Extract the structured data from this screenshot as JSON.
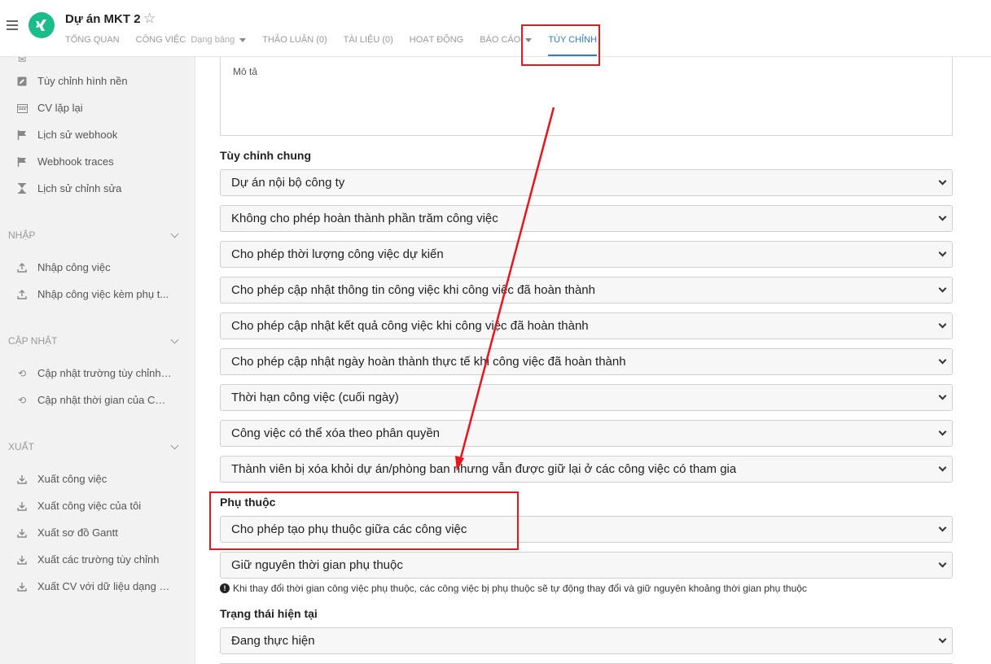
{
  "header": {
    "title": "Dự án MKT 2",
    "tabs": [
      {
        "label": "TỔNG QUAN"
      },
      {
        "label": "CÔNG VIỆC",
        "sub": "Dạng bảng"
      },
      {
        "label": "THẢO LUẬN (0)"
      },
      {
        "label": "TÀI LIỆU (0)"
      },
      {
        "label": "HOẠT ĐỘNG"
      },
      {
        "label": "BÁO CÁO"
      },
      {
        "label": "TÙY CHỈNH",
        "active": true
      }
    ]
  },
  "sidebar": {
    "top_items": [
      {
        "label": "Tùy chỉnh hình nền",
        "icon": "image-edit-icon"
      },
      {
        "label": "CV lặp lại",
        "icon": "calendar-icon"
      },
      {
        "label": "Lịch sử webhook",
        "icon": "flag-icon"
      },
      {
        "label": "Webhook traces",
        "icon": "flag-icon"
      },
      {
        "label": "Lịch sử chỉnh sửa",
        "icon": "hourglass-icon"
      }
    ],
    "sections": [
      {
        "title": "NHẬP",
        "items": [
          {
            "label": "Nhập công việc",
            "icon": "upload-icon"
          },
          {
            "label": "Nhập công việc kèm phụ t...",
            "icon": "upload-icon"
          }
        ]
      },
      {
        "title": "CẬP NHẬT",
        "items": [
          {
            "label": "Cập nhật trường tùy chỉnh ...",
            "icon": "sync-icon"
          },
          {
            "label": "Cập nhật thời gian của CV ...",
            "icon": "sync-icon"
          }
        ]
      },
      {
        "title": "XUẤT",
        "items": [
          {
            "label": "Xuất công việc",
            "icon": "download-icon"
          },
          {
            "label": "Xuất công việc của tôi",
            "icon": "download-icon"
          },
          {
            "label": "Xuất sơ đồ Gantt",
            "icon": "download-icon"
          },
          {
            "label": "Xuất các trường tùy chỉnh",
            "icon": "download-icon"
          },
          {
            "label": "Xuất CV với dữ liệu dạng b...",
            "icon": "download-icon"
          }
        ]
      }
    ]
  },
  "main": {
    "description_placeholder": "Mô tả",
    "general_title": "Tùy chỉnh chung",
    "general_selects": [
      "Dự án nội bộ công ty",
      "Không cho phép hoàn thành phần trăm công việc",
      "Cho phép thời lượng công việc dự kiến",
      "Cho phép cập nhật thông tin công việc khi công việc đã hoàn thành",
      "Cho phép cập nhật kết quả công việc khi công việc đã hoàn thành",
      "Cho phép cập nhật ngày hoàn thành thực tế khi công việc đã hoàn thành",
      "Thời hạn công việc (cuối ngày)",
      "Công việc có thể xóa theo phân quyền",
      "Thành viên bị xóa khỏi dự án/phòng ban nhưng vẫn được giữ lại ở các công việc có tham gia"
    ],
    "dependency_title": "Phụ thuộc",
    "dependency_selects": [
      "Cho phép tạo phụ thuộc giữa các công việc",
      "Giữ nguyên thời gian phụ thuộc"
    ],
    "dependency_info": "Khi thay đổi thời gian công việc phụ thuộc, các công việc bị phụ thuộc sẽ tự động thay đổi và giữ nguyên khoảng thời gian phụ thuộc",
    "status_title": "Trạng thái hiện tại",
    "status_select": "Đang thực hiện"
  },
  "colors": {
    "accent": "#2b7cd3",
    "logo": "#1bbc8b",
    "annotation": "#e8151c"
  }
}
